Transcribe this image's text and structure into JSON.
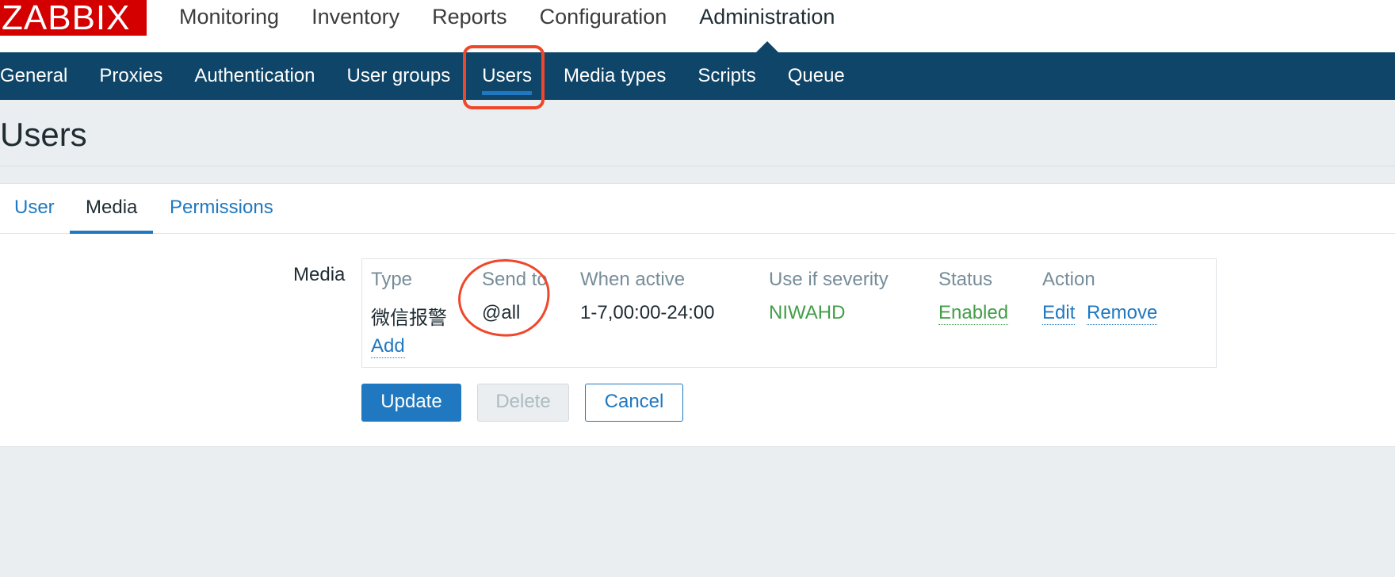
{
  "header": {
    "logo": "ZABBIX",
    "main_menu": [
      {
        "label": "Monitoring"
      },
      {
        "label": "Inventory"
      },
      {
        "label": "Reports"
      },
      {
        "label": "Configuration"
      },
      {
        "label": "Administration",
        "active": true
      }
    ]
  },
  "submenu": {
    "items": [
      {
        "label": "General"
      },
      {
        "label": "Proxies"
      },
      {
        "label": "Authentication"
      },
      {
        "label": "User groups"
      },
      {
        "label": "Users",
        "active": true
      },
      {
        "label": "Media types"
      },
      {
        "label": "Scripts"
      },
      {
        "label": "Queue"
      }
    ]
  },
  "page": {
    "title": "Users"
  },
  "form": {
    "tabs": [
      {
        "label": "User"
      },
      {
        "label": "Media",
        "active": true
      },
      {
        "label": "Permissions"
      }
    ],
    "media_label": "Media",
    "media_table": {
      "headers": [
        "Type",
        "Send to",
        "When active",
        "Use if severity",
        "Status",
        "Action"
      ],
      "rows": [
        {
          "type": "微信报警",
          "send_to": "@all",
          "when_active": "1-7,00:00-24:00",
          "severity": "NIWAHD",
          "status": "Enabled",
          "action_edit": "Edit",
          "action_remove": "Remove"
        }
      ],
      "add_label": "Add"
    },
    "buttons": {
      "update": "Update",
      "delete": "Delete",
      "cancel": "Cancel"
    }
  },
  "colors": {
    "logo_red": "#d40000",
    "submenu_bg": "#0e4568",
    "accent_blue": "#1f78c0",
    "enabled_green": "#429e47",
    "annotation_red": "#f0472a"
  }
}
